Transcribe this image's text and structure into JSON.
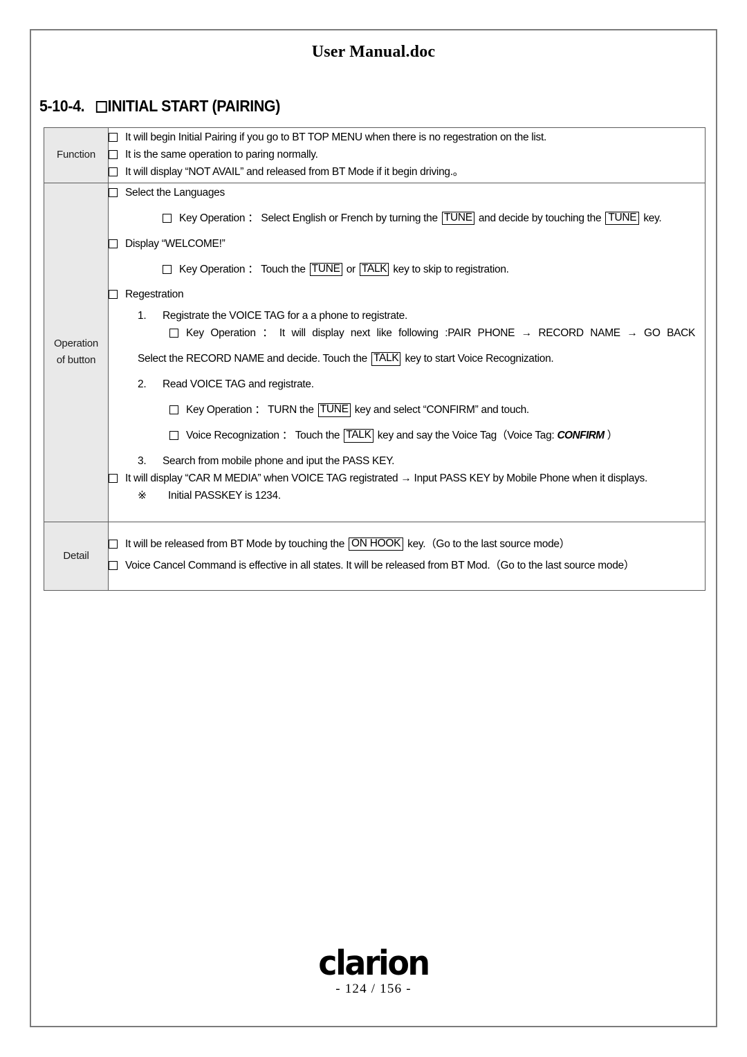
{
  "document": {
    "header_title": "User Manual.doc",
    "section_number": "5-10-4.",
    "section_title": "INITIAL START (PAIRING)"
  },
  "table": {
    "labels": {
      "function": "Function",
      "operation_line1": "Operation",
      "operation_line2": "of button",
      "detail": "Detail"
    },
    "function_items": [
      "It will begin Initial Pairing if you go to BT TOP MENU when there is no regestration on the list.",
      "It is the same operation to paring normally.",
      "It will display “NOT AVAIL” and released from BT Mode if it begin driving.。"
    ],
    "operation": {
      "item_select_languages": "Select the Languages",
      "key_op_label": "Key Operation",
      "colon": "：",
      "select_languages_key_op": {
        "part1": "Select English or French by turning the",
        "key1": "TUNE",
        "part2": "and decide by touching the",
        "key2": "TUNE",
        "part3": "key."
      },
      "item_display_welcome": "Display “WELCOME!”",
      "welcome_key_op": {
        "part1": "Touch the",
        "key1": "TUNE",
        "part2": "or",
        "key2": "TALK",
        "part3": "key to skip to registration."
      },
      "item_regestration": "Regestration",
      "step1": {
        "num": "1.",
        "text": "Registrate the VOICE TAG for a a phone to registrate.",
        "key_op_text": "It will display next like following :PAIR PHONE → RECORD NAME → GO BACK",
        "follow_part1": "Select the RECORD NAME and decide. Touch the",
        "follow_key": "TALK",
        "follow_part2": "key to start Voice Recognization."
      },
      "step2": {
        "num": "2.",
        "text": "Read VOICE TAG and registrate.",
        "key_op": {
          "part1": "TURN the",
          "key1": "TUNE",
          "part2": "key and select “CONFIRM” and touch."
        },
        "voice_recog_label": "Voice Recognization",
        "voice_recog": {
          "part1": "Touch the",
          "key1": "TALK",
          "part2": "key and say the Voice Tag（Voice Tag:",
          "emphasis": "CONFIRM",
          "part3": "）"
        }
      },
      "step3": {
        "num": "3.",
        "text": "Search from mobile phone and iput the PASS KEY."
      },
      "car_m_media": "It will display “CAR M MEDIA” when VOICE TAG registrated → Input PASS KEY by Mobile Phone when it displays.",
      "note_mark": "※",
      "note_text": "Initial PASSKEY is 1234."
    },
    "detail_items": [
      {
        "part1": "It will be released from BT Mode by touching the",
        "key": "ON HOOK",
        "part2": "key.（Go to the last source mode）"
      },
      {
        "part1": "Voice Cancel Command is effective in all states. It will be released from BT Mod.（Go to the last source mode）",
        "key": "",
        "part2": ""
      }
    ]
  },
  "footer": {
    "brand": "clarion",
    "page_number": "- 124 / 156 -"
  },
  "colors": {
    "label_background": "#e9e9e9",
    "frame_border": "#7a7a7a",
    "table_border": "#5a5a5a",
    "text": "#000000"
  }
}
